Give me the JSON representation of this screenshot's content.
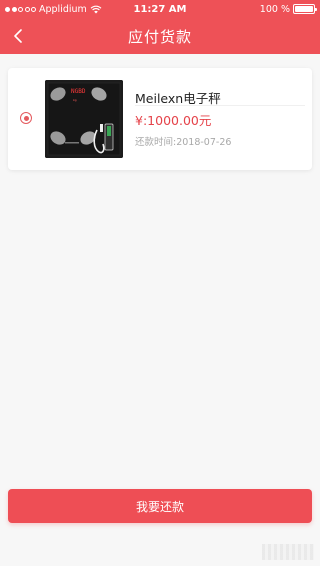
{
  "status_bar": {
    "carrier": "Applidium",
    "time": "11:27 AM",
    "battery": "100 %",
    "battery_level": 1.0
  },
  "nav": {
    "title": "应付货款",
    "back_icon": "chevron-left-icon"
  },
  "order": {
    "selected": true,
    "product_name": "Meilexn电子秤",
    "price": "¥:1000.00元",
    "repay_date": "还款时间:2018-07-26",
    "scale_display": "NGBD"
  },
  "footer": {
    "repay_button_label": "我要还款"
  },
  "colors": {
    "brand_red": "#ee5157",
    "price_red": "#e5434a",
    "background": "#f7f7f7"
  }
}
